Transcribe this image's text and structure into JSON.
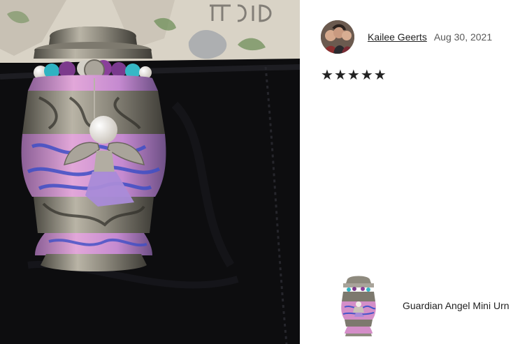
{
  "photo": {
    "icon": "urn-photo",
    "colors": {
      "cloth": "#0d0d0f",
      "pink": "#d48ec8",
      "blue": "#4656c9",
      "pewter": "#8e8a7e",
      "angel": "#a98bd8"
    }
  },
  "review": {
    "reviewer_name": "Kailee Geerts",
    "date": "Aug 30, 2021",
    "rating": 5,
    "stars": [
      "★",
      "★",
      "★",
      "★",
      "★"
    ]
  },
  "product": {
    "name": "Guardian Angel Mini Urn",
    "thumb_icon": "urn-thumbnail"
  }
}
